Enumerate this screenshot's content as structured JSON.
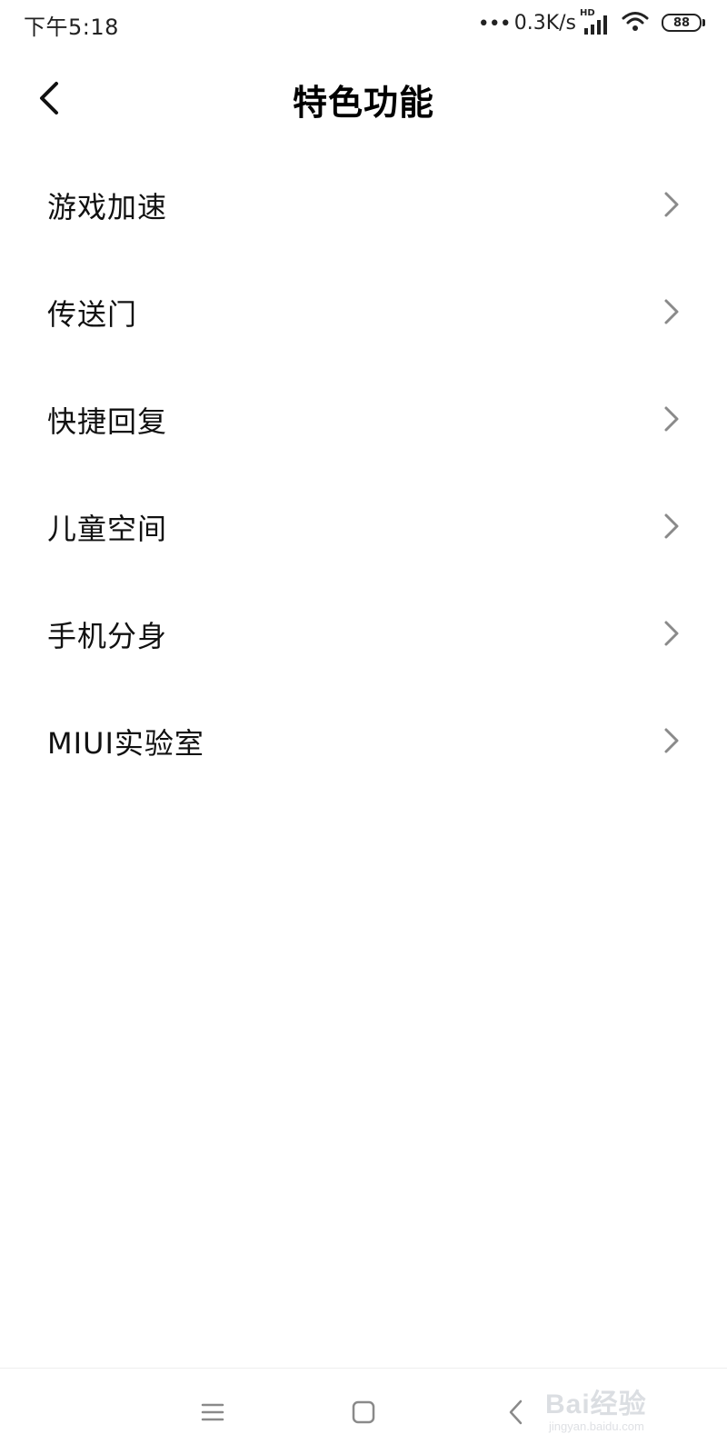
{
  "status_bar": {
    "time": "下午5:18",
    "dots": "•••",
    "net_speed": "0.3K/s",
    "hd_label": "HD",
    "battery_level": "88",
    "icons": [
      "signal-icon",
      "wifi-icon",
      "battery-icon"
    ]
  },
  "header": {
    "title": "特色功能",
    "back_icon": "chevron-left-icon"
  },
  "menu": {
    "items": [
      {
        "label": "游戏加速"
      },
      {
        "label": "传送门"
      },
      {
        "label": "快捷回复"
      },
      {
        "label": "儿童空间"
      },
      {
        "label": "手机分身"
      },
      {
        "label": "MIUI实验室"
      }
    ],
    "chevron_icon": "chevron-right-icon"
  },
  "nav_bar": {
    "icons": [
      "menu-icon",
      "home-icon",
      "back-icon"
    ]
  },
  "watermark": {
    "brand": "Bai经验",
    "url": "jingyan.baidu.com"
  },
  "colors": {
    "background": "#ffffff",
    "text": "#111111",
    "chevron": "#8a8a8a",
    "nav_icon": "#8a8a8a"
  }
}
